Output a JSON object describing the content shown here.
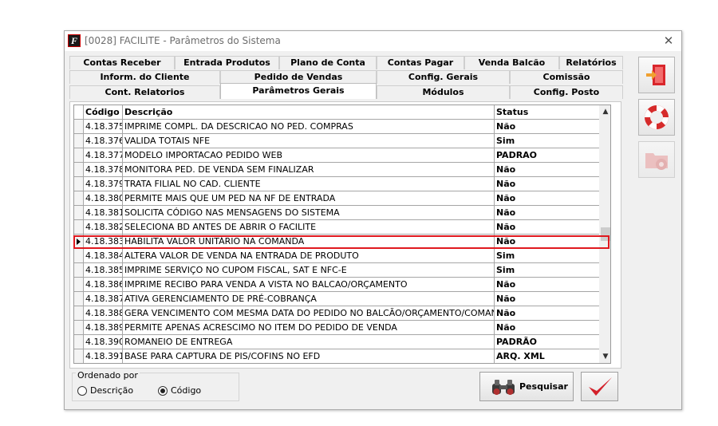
{
  "window": {
    "title": "[0028] FACILITE - Parâmetros do Sistema",
    "close_glyph": "✕",
    "app_icon_letter": "F"
  },
  "tabs": {
    "row1": [
      "Contas Receber",
      "Entrada Produtos",
      "Plano de Conta",
      "Contas Pagar",
      "Venda Balcão",
      "Relatórios"
    ],
    "row2": [
      "Inform. do Cliente",
      "Pedido de Vendas",
      "Config. Gerais",
      "Comissão"
    ],
    "row3": [
      "Cont. Relatorios",
      "Parâmetros Gerais",
      "Módulos",
      "Config. Posto"
    ],
    "active": "Parâmetros Gerais"
  },
  "grid": {
    "headers": {
      "codigo": "Código",
      "descricao": "Descrição",
      "status": "Status"
    },
    "rows": [
      {
        "codigo": "4.18.375",
        "descricao": "IMPRIME COMPL. DA DESCRICAO NO PED. COMPRAS",
        "status": "Não"
      },
      {
        "codigo": "4.18.376",
        "descricao": "VALIDA TOTAIS NFE",
        "status": "Sim"
      },
      {
        "codigo": "4.18.377",
        "descricao": "MODELO IMPORTACAO PEDIDO WEB",
        "status": "PADRAO"
      },
      {
        "codigo": "4.18.378",
        "descricao": "MONITORA PED. DE VENDA SEM FINALIZAR",
        "status": "Não"
      },
      {
        "codigo": "4.18.379",
        "descricao": "TRATA FILIAL NO CAD. CLIENTE",
        "status": "Não"
      },
      {
        "codigo": "4.18.380",
        "descricao": "PERMITE MAIS QUE UM PED NA NF DE ENTRADA",
        "status": "Não"
      },
      {
        "codigo": "4.18.381",
        "descricao": "SOLICITA CÓDIGO NAS MENSAGENS DO SISTEMA",
        "status": "Não"
      },
      {
        "codigo": "4.18.382",
        "descricao": "SELECIONA BD ANTES DE ABRIR O FACILITE",
        "status": "Não"
      },
      {
        "codigo": "4.18.383",
        "descricao": "HABILITA VALOR UNITÁRIO NA COMANDA",
        "status": "Não"
      },
      {
        "codigo": "4.18.384",
        "descricao": "ALTERA VALOR DE VENDA NA ENTRADA DE PRODUTO",
        "status": "Sim"
      },
      {
        "codigo": "4.18.385",
        "descricao": "IMPRIME SERVIÇO NO CUPOM FISCAL, SAT E NFC-E",
        "status": "Sim"
      },
      {
        "codigo": "4.18.386",
        "descricao": "IMPRIME RECIBO PARA VENDA A VISTA NO BALCAO/ORÇAMENTO",
        "status": "Não"
      },
      {
        "codigo": "4.18.387",
        "descricao": "ATIVA GERENCIAMENTO DE PRÉ-COBRANÇA",
        "status": "Não"
      },
      {
        "codigo": "4.18.388",
        "descricao": "GERA VENCIMENTO COM MESMA DATA DO PEDIDO NO BALCÃO/ORÇAMENTO/COMANDA",
        "status": "Não"
      },
      {
        "codigo": "4.18.389",
        "descricao": "PERMITE APENAS ACRESCIMO NO ITEM DO PEDIDO DE VENDA",
        "status": "Não"
      },
      {
        "codigo": "4.18.390",
        "descricao": "ROMANEIO DE ENTREGA",
        "status": "PADRÃO"
      },
      {
        "codigo": "4.18.391",
        "descricao": "BASE PARA CAPTURA DE PIS/COFINS NO EFD",
        "status": "ARQ. XML"
      }
    ],
    "selected_codigo": "4.18.383"
  },
  "order": {
    "title": "Ordenado por",
    "options": [
      "Descrição",
      "Código"
    ],
    "selected": "Código"
  },
  "buttons": {
    "search_label": "Pesquisar"
  },
  "colors": {
    "highlight_border": "#e0191f",
    "confirm_check": "#d3202a",
    "exit_door": "#d9262c"
  }
}
